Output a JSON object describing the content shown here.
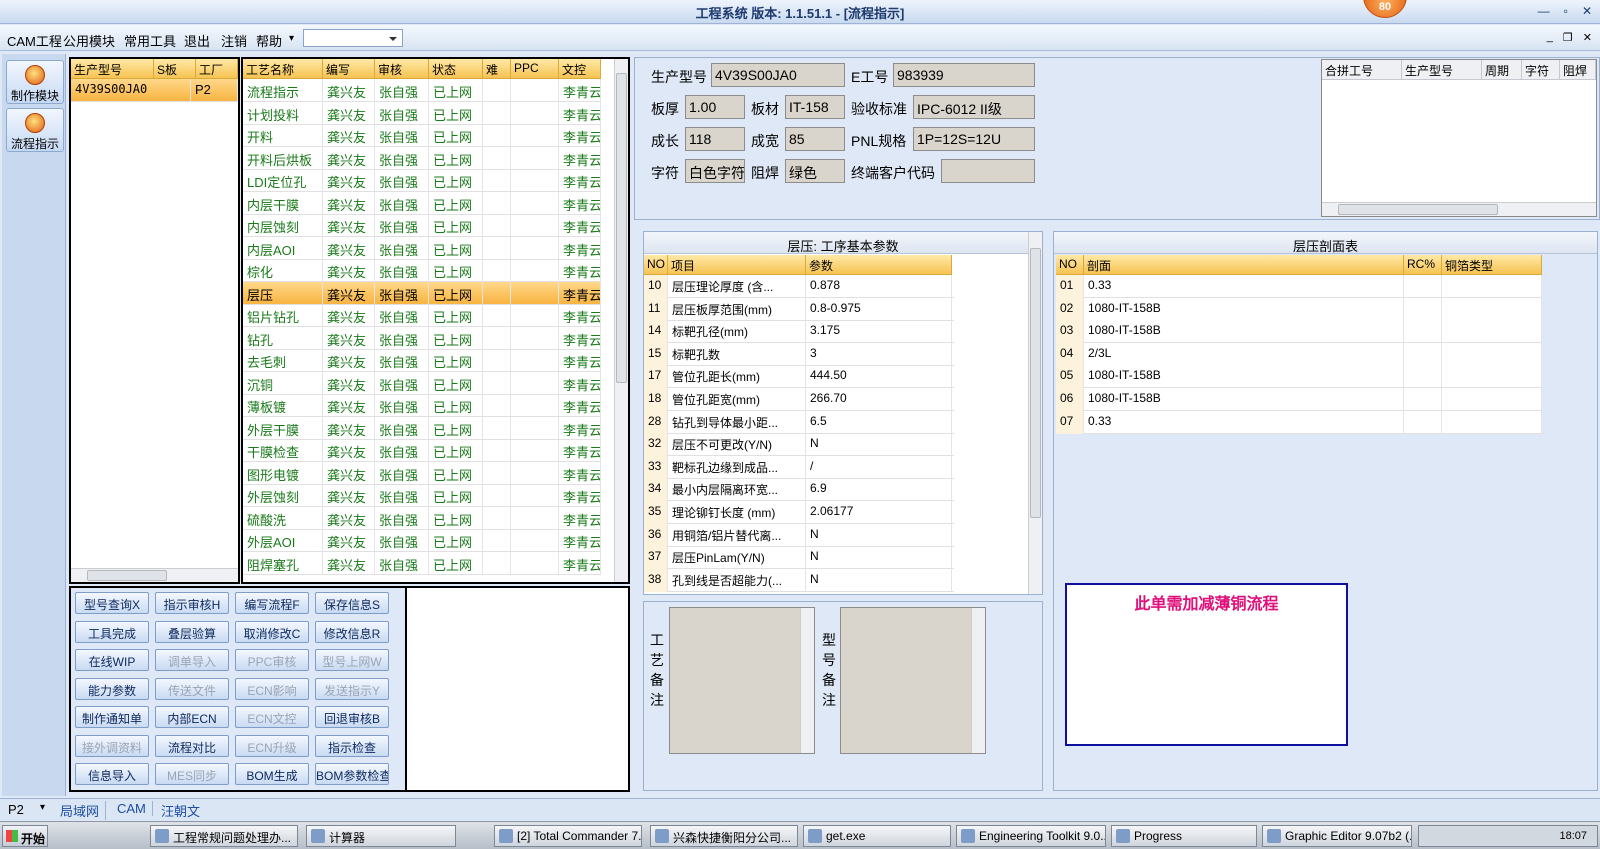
{
  "window": {
    "title": "工程系统  版本: 1.1.51.1 - [流程指示]",
    "badge": "80"
  },
  "menu": {
    "items": [
      "CAM工程",
      "公用模块",
      "常用工具",
      "退出",
      "注销",
      "帮助"
    ],
    "help_arrow": "▾",
    "combo_value": ""
  },
  "leftbar": {
    "btn1": "制作模块",
    "btn2": "流程指示"
  },
  "model_list": {
    "headers": [
      "生产型号",
      "S板",
      "工厂"
    ],
    "rows": [
      {
        "model": "4V39S00JA0",
        "s": "",
        "factory": "P2"
      }
    ]
  },
  "process_grid": {
    "headers": [
      "工艺名称",
      "编写",
      "审核",
      "状态",
      "难",
      "PPC",
      "文控"
    ],
    "rows": [
      {
        "name": "流程指示",
        "writer": "龚兴友",
        "review": "张自强",
        "status": "已上网",
        "ctrl": "李青云"
      },
      {
        "name": "计划投料",
        "writer": "龚兴友",
        "review": "张自强",
        "status": "已上网",
        "ctrl": "李青云"
      },
      {
        "name": "开料",
        "writer": "龚兴友",
        "review": "张自强",
        "status": "已上网",
        "ctrl": "李青云"
      },
      {
        "name": "开料后烘板",
        "writer": "龚兴友",
        "review": "张自强",
        "status": "已上网",
        "ctrl": "李青云"
      },
      {
        "name": "LDI定位孔",
        "writer": "龚兴友",
        "review": "张自强",
        "status": "已上网",
        "ctrl": "李青云"
      },
      {
        "name": "内层干膜",
        "writer": "龚兴友",
        "review": "张自强",
        "status": "已上网",
        "ctrl": "李青云"
      },
      {
        "name": "内层蚀刻",
        "writer": "龚兴友",
        "review": "张自强",
        "status": "已上网",
        "ctrl": "李青云"
      },
      {
        "name": "内层AOI",
        "writer": "龚兴友",
        "review": "张自强",
        "status": "已上网",
        "ctrl": "李青云"
      },
      {
        "name": "棕化",
        "writer": "龚兴友",
        "review": "张自强",
        "status": "已上网",
        "ctrl": "李青云"
      },
      {
        "name": "层压",
        "writer": "龚兴友",
        "review": "张自强",
        "status": "已上网",
        "ctrl": "李青云"
      },
      {
        "name": "铝片钻孔",
        "writer": "龚兴友",
        "review": "张自强",
        "status": "已上网",
        "ctrl": "李青云"
      },
      {
        "name": "钻孔",
        "writer": "龚兴友",
        "review": "张自强",
        "status": "已上网",
        "ctrl": "李青云"
      },
      {
        "name": "去毛刺",
        "writer": "龚兴友",
        "review": "张自强",
        "status": "已上网",
        "ctrl": "李青云"
      },
      {
        "name": "沉铜",
        "writer": "龚兴友",
        "review": "张自强",
        "status": "已上网",
        "ctrl": "李青云"
      },
      {
        "name": "薄板镀",
        "writer": "龚兴友",
        "review": "张自强",
        "status": "已上网",
        "ctrl": "李青云"
      },
      {
        "name": "外层干膜",
        "writer": "龚兴友",
        "review": "张自强",
        "status": "已上网",
        "ctrl": "李青云"
      },
      {
        "name": "干膜检查",
        "writer": "龚兴友",
        "review": "张自强",
        "status": "已上网",
        "ctrl": "李青云"
      },
      {
        "name": "图形电镀",
        "writer": "龚兴友",
        "review": "张自强",
        "status": "已上网",
        "ctrl": "李青云"
      },
      {
        "name": "外层蚀刻",
        "writer": "龚兴友",
        "review": "张自强",
        "status": "已上网",
        "ctrl": "李青云"
      },
      {
        "name": "硫酸洗",
        "writer": "龚兴友",
        "review": "张自强",
        "status": "已上网",
        "ctrl": "李青云"
      },
      {
        "name": "外层AOI",
        "writer": "龚兴友",
        "review": "张自强",
        "status": "已上网",
        "ctrl": "李青云"
      },
      {
        "name": "阻焊塞孔",
        "writer": "龚兴友",
        "review": "张自强",
        "status": "已上网",
        "ctrl": "李青云"
      }
    ],
    "selected_index": 9
  },
  "func_buttons": [
    [
      "型号查询X",
      "指示审核H",
      "编写流程F",
      "保存信息S"
    ],
    [
      "工具完成",
      "叠层验算",
      "取消修改C",
      "修改信息R"
    ],
    [
      "在线WIP",
      "调单导入",
      "PPC审核",
      "型号上网W"
    ],
    [
      "能力参数",
      "传送文件",
      "ECN影响",
      "发送指示Y"
    ],
    [
      "制作通知单",
      "内部ECN",
      "ECN文控",
      "回退审核B"
    ],
    [
      "接外调资料",
      "流程对比",
      "ECN升级",
      "指示检查"
    ],
    [
      "信息导入",
      "MES同步",
      "BOM生成",
      "BOM参数检查"
    ]
  ],
  "func_disabled": [
    [
      false,
      false,
      false,
      false
    ],
    [
      false,
      false,
      false,
      false
    ],
    [
      false,
      true,
      true,
      true
    ],
    [
      false,
      true,
      true,
      true
    ],
    [
      false,
      false,
      true,
      false
    ],
    [
      true,
      false,
      true,
      false
    ],
    [
      false,
      true,
      false,
      false
    ]
  ],
  "info": {
    "model_label": "生产型号",
    "model": "4V39S00JA0",
    "eno_label": "E工号",
    "eno": "983939",
    "thick_label": "板厚",
    "thick": "1.00",
    "mat_label": "板材",
    "mat": "IT-158",
    "std_label": "验收标准",
    "std": "IPC-6012 II级",
    "len_label": "成长",
    "len": "118",
    "wid_label": "成宽",
    "wid": "85",
    "pnl_label": "PNL规格",
    "pnl": "1P=12S=12U",
    "char_label": "字符",
    "char": "白色字符",
    "mask_label": "阻焊",
    "mask": "绿色",
    "cust_label": "终端客户代码",
    "cust": ""
  },
  "merge_table": {
    "headers": [
      "合拼工号",
      "生产型号",
      "周期",
      "字符",
      "阻焊"
    ]
  },
  "params": {
    "title": "层压: 工序基本参数",
    "headers": [
      "NO",
      "项目",
      "参数"
    ],
    "rows": [
      {
        "no": "10",
        "item": "层压理论厚度 (含...",
        "val": "0.878"
      },
      {
        "no": "11",
        "item": "层压板厚范围(mm)",
        "val": "0.8-0.975"
      },
      {
        "no": "14",
        "item": "标靶孔径(mm)",
        "val": "3.175"
      },
      {
        "no": "15",
        "item": "标靶孔数",
        "val": "3"
      },
      {
        "no": "17",
        "item": "管位孔距长(mm)",
        "val": "444.50"
      },
      {
        "no": "18",
        "item": "管位孔距宽(mm)",
        "val": "266.70"
      },
      {
        "no": "28",
        "item": "钻孔到导体最小距...",
        "val": "6.5"
      },
      {
        "no": "32",
        "item": "层压不可更改(Y/N)",
        "val": "N"
      },
      {
        "no": "33",
        "item": "靶标孔边缘到成品...",
        "val": "/"
      },
      {
        "no": "34",
        "item": "最小内层隔离环宽...",
        "val": "6.9"
      },
      {
        "no": "35",
        "item": "理论铆钉长度 (mm)",
        "val": "2.06177"
      },
      {
        "no": "36",
        "item": "用铜箔/铝片替代离...",
        "val": "N"
      },
      {
        "no": "37",
        "item": "层压PinLam(Y/N)",
        "val": "N"
      },
      {
        "no": "38",
        "item": "孔到线是否超能力(...",
        "val": "N"
      }
    ]
  },
  "stack": {
    "title": "层压剖面表",
    "headers": [
      "NO",
      "剖面",
      "RC%",
      "铜箔类型"
    ],
    "rows": [
      {
        "no": "01",
        "sec": "0.33"
      },
      {
        "no": "02",
        "sec": "1080-IT-158B"
      },
      {
        "no": "03",
        "sec": "1080-IT-158B"
      },
      {
        "no": "04",
        "sec": "2/3L"
      },
      {
        "no": "05",
        "sec": "1080-IT-158B"
      },
      {
        "no": "06",
        "sec": "1080-IT-158B"
      },
      {
        "no": "07",
        "sec": "0.33"
      }
    ]
  },
  "remarks": {
    "process_label": "工艺备注",
    "model_label": "型号备注"
  },
  "notice": "此单需加减薄铜流程",
  "bottom_tabs": {
    "combo": "P2",
    "tabs": [
      "局域网",
      "CAM",
      "汪朝文"
    ]
  },
  "taskbar": {
    "start": "开始",
    "items": [
      "工程常规问题处理办...",
      "计算器",
      "[2] Total Commander 7...",
      "兴森快捷衡阳分公司...",
      "get.exe",
      "Engineering Toolkit 9.0...",
      "Progress",
      "Graphic Editor 9.07b2 (..."
    ],
    "clock": "18:07"
  },
  "colors": {
    "accent": "#f8b441",
    "notice_border": "#1010a0",
    "notice_text": "#e0107a",
    "green_text": "#1a7a1a"
  }
}
